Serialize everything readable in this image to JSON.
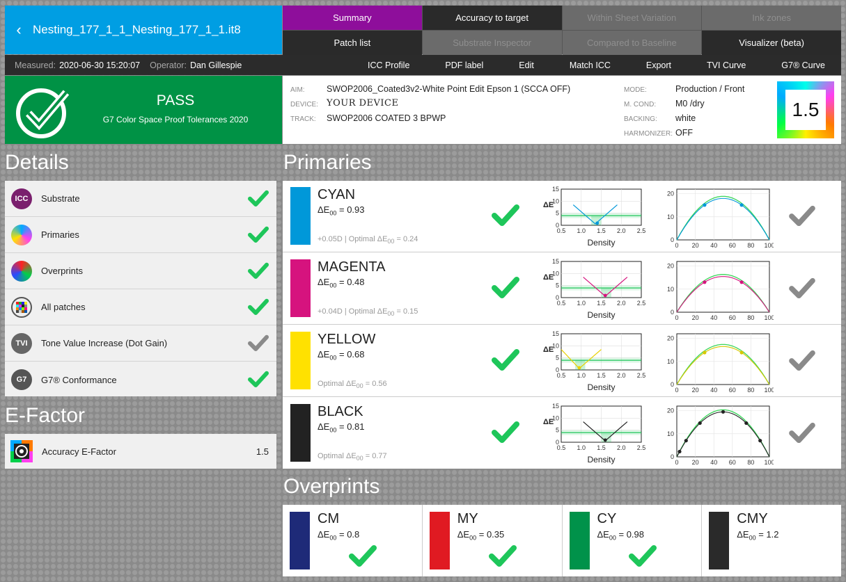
{
  "header": {
    "title": "Nesting_177_1_1_Nesting_177_1_1.it8",
    "tabs": [
      {
        "label": "Summary",
        "state": "active"
      },
      {
        "label": "Accuracy to target",
        "state": "normal"
      },
      {
        "label": "Within Sheet Variation",
        "state": "disabled"
      },
      {
        "label": "Ink zones",
        "state": "disabled"
      },
      {
        "label": "Patch list",
        "state": "normal"
      },
      {
        "label": "Substrate Inspector",
        "state": "disabled"
      },
      {
        "label": "Compared to Baseline",
        "state": "disabled"
      },
      {
        "label": "Visualizer (beta)",
        "state": "normal"
      }
    ],
    "measured_label": "Measured:",
    "measured_value": "2020-06-30 15:20:07",
    "operator_label": "Operator:",
    "operator_value": "Dan Gillespie",
    "menu": [
      "ICC Profile",
      "PDF label",
      "Edit",
      "Match ICC",
      "Export",
      "TVI Curve",
      "G7® Curve"
    ]
  },
  "status": {
    "result": "PASS",
    "tolerance": "G7 Color Space Proof Tolerances 2020",
    "aim_label": "AIM:",
    "aim": "SWOP2006_Coated3v2-White Point Edit Epson 1 (SCCA OFF)",
    "device_label": "DEVICE:",
    "device": "YOUR DEVICE",
    "track_label": "TRACK:",
    "track": "SWOP2006 COATED 3 BPWP",
    "mode_label": "MODE:",
    "mode": "Production / Front",
    "mcond_label": "M. COND:",
    "mcond": "M0 /dry",
    "backing_label": "BACKING:",
    "backing": "white",
    "harmonizer_label": "HARMONIZER:",
    "harmonizer": "OFF",
    "efactor": "1.5"
  },
  "details": {
    "heading": "Details",
    "items": [
      {
        "label": "Substrate",
        "icon": "icc-icon",
        "icon_text": "ICC",
        "status": "pass"
      },
      {
        "label": "Primaries",
        "icon": "delta-e-icon",
        "icon_text": "ΔE",
        "status": "pass"
      },
      {
        "label": "Overprints",
        "icon": "delta-e-icon",
        "icon_text": "ΔE",
        "status": "pass"
      },
      {
        "label": "All patches",
        "icon": "patches-icon",
        "icon_text": "",
        "status": "pass"
      },
      {
        "label": "Tone Value Increase (Dot Gain)",
        "icon": "tvi-icon",
        "icon_text": "TVI",
        "status": "neutral"
      },
      {
        "label": "G7® Conformance",
        "icon": "g7-icon",
        "icon_text": "G7",
        "status": "pass"
      }
    ]
  },
  "efactor": {
    "heading": "E-Factor",
    "label": "Accuracy E-Factor",
    "value": "1.5"
  },
  "primaries": {
    "heading": "Primaries",
    "delta_label": "ΔE",
    "subscript": "00",
    "density_label": "Density",
    "items": [
      {
        "name": "CYAN",
        "de": "0.93",
        "offset": "+0.05D",
        "optimal": "0.24",
        "color": "#0098d9",
        "curve_color": "#0098d9",
        "dens_min": 1.35,
        "dens_opt": 1.4,
        "cmp_pts": [
          30,
          70
        ]
      },
      {
        "name": "MAGENTA",
        "de": "0.48",
        "offset": "+0.04D",
        "optimal": "0.15",
        "color": "#d6137e",
        "curve_color": "#d6137e",
        "dens_min": 1.6,
        "dens_opt": 1.6,
        "cmp_pts": [
          30,
          70
        ]
      },
      {
        "name": "YELLOW",
        "de": "0.68",
        "offset": "",
        "optimal": "0.56",
        "color": "#ffe100",
        "curve_color": "#ffe100",
        "dens_min": 0.95,
        "dens_opt": 0.95,
        "cmp_pts": [
          30,
          70
        ]
      },
      {
        "name": "BLACK",
        "de": "0.81",
        "offset": "",
        "optimal": "0.77",
        "color": "#222222",
        "curve_color": "#222222",
        "dens_min": 1.6,
        "dens_opt": 1.6,
        "cmp_pts": [
          3,
          10,
          25,
          50,
          75,
          90
        ]
      }
    ]
  },
  "overprints": {
    "heading": "Overprints",
    "items": [
      {
        "name": "CM",
        "de": "0.8",
        "color": "#1e2a78",
        "pass": true
      },
      {
        "name": "MY",
        "de": "0.35",
        "color": "#e01a22",
        "pass": true
      },
      {
        "name": "CY",
        "de": "0.98",
        "color": "#00924a",
        "pass": true
      },
      {
        "name": "CMY",
        "de": "1.2",
        "color": "#2a2a2a",
        "pass": false
      }
    ]
  },
  "chart_data": [
    {
      "type": "line",
      "title": "",
      "xlabel": "Density",
      "ylabel": "ΔE",
      "xlim": [
        0.5,
        2.5
      ],
      "ylim": [
        0,
        15
      ],
      "xticks": [
        "0.5",
        "1.0",
        "1.5",
        "2.0",
        "2.5"
      ],
      "yticks": [
        "0",
        "5",
        "10",
        "15"
      ],
      "grid": true
    },
    {
      "type": "line",
      "title": "",
      "xlabel": "",
      "ylabel": "",
      "xlim": [
        0,
        100
      ],
      "ylim": [
        0,
        22
      ],
      "xticks": [
        "0",
        "20",
        "40",
        "60",
        "80",
        "100"
      ],
      "yticks": [
        "0",
        "10",
        "20"
      ],
      "grid": true
    }
  ],
  "colors": {
    "pass": "#1ec65a",
    "neutral": "#8a8a8a",
    "accent": "#8e0e9b",
    "brand": "#009ee3"
  }
}
